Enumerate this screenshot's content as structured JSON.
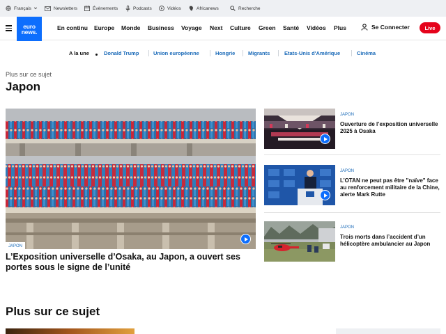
{
  "utility_bar": {
    "items": [
      {
        "icon": "globe-icon",
        "label": "Français",
        "has_caret": true
      },
      {
        "icon": "mail-icon",
        "label": "Newsletters"
      },
      {
        "icon": "calendar-icon",
        "label": "Évènements"
      },
      {
        "icon": "microphone-icon",
        "label": "Podcasts"
      },
      {
        "icon": "play-circle-icon",
        "label": "Vidéos"
      },
      {
        "icon": "africanews-icon",
        "label": "Africanews"
      },
      {
        "icon": "search-icon",
        "label": "Recherche"
      }
    ]
  },
  "header": {
    "logo_top": "euro",
    "logo_bottom": "news.",
    "nav": [
      "En continu",
      "Europe",
      "Monde",
      "Business",
      "Voyage",
      "Next",
      "Culture",
      "Green",
      "Santé",
      "Vidéos",
      "Plus"
    ],
    "login_label": "Se Connecter",
    "live_label": "Live"
  },
  "topics": {
    "first": "A la une",
    "items": [
      "Donald Trump",
      "Union européenne",
      "Hongrie",
      "Migrants",
      "Etats-Unis d'Amérique",
      "Cinéma"
    ]
  },
  "page": {
    "kicker": "Plus sur ce sujet",
    "title": "Japon"
  },
  "hero": {
    "tag": "JAPON",
    "title": "L’Exposition universelle d’Osaka, au Japon, a ouvert ses portes sous le signe de l’unité"
  },
  "side_articles": [
    {
      "tag": "JAPON",
      "title": "Ouverture de l’exposition universelle 2025 à Osaka"
    },
    {
      "tag": "JAPON",
      "title": "L’OTAN ne peut pas être \"naïve\" face au renforcement militaire de la Chine, alerte Mark Rutte"
    },
    {
      "tag": "JAPON",
      "title": "Trois morts dans l’accident d’un hélicoptère ambulancier au Japon"
    }
  ],
  "more_section": {
    "title": "Plus sur ce sujet"
  },
  "colors": {
    "brand_blue": "#0d6efd",
    "link_blue": "#1a6ab8",
    "live_red": "#e5031b",
    "utility_bg": "#eef0f3"
  }
}
